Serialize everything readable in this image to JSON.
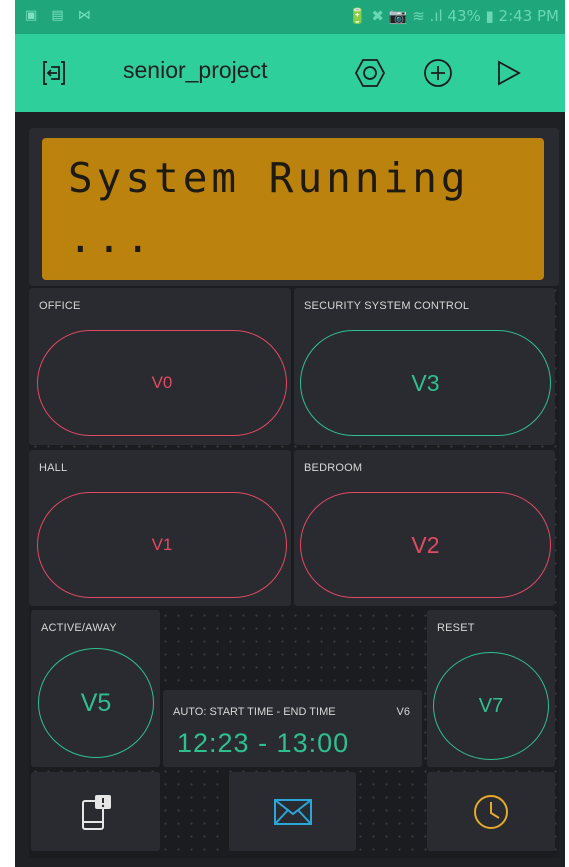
{
  "status_bar": {
    "left_icons": "▣ ▤ ⋈",
    "right_text": "🔋 ✖ 📷 ≋ .ıl 43% ▮ 2:43 PM"
  },
  "toolbar": {
    "title": "senior_project",
    "icons": [
      "exit-icon",
      "settings-icon",
      "add-icon",
      "play-icon"
    ]
  },
  "lcd": {
    "line1": "System Running",
    "line2": "..."
  },
  "widgets": {
    "office": {
      "label": "OFFICE",
      "pin": "V0"
    },
    "security": {
      "label": "SECURITY SYSTEM CONTROL",
      "pin": "V3"
    },
    "hall": {
      "label": "HALL",
      "pin": "V1"
    },
    "bedroom": {
      "label": "BEDROOM",
      "pin": "V2"
    },
    "active_away": {
      "label": "ACTIVE/AWAY",
      "pin": "V5"
    },
    "reset": {
      "label": "RESET",
      "pin": "V7"
    },
    "timer": {
      "label": "AUTO: START TIME - END TIME",
      "pin": "V6",
      "value": "12:23 - 13:00"
    }
  },
  "bottom_icons": [
    "notification-icon",
    "email-icon",
    "clock-icon"
  ],
  "colors": {
    "accent_green": "#2fc08f",
    "accent_red": "#e04a63",
    "toolbar": "#2ecf9a",
    "lcd": "#bb820d",
    "clock": "#e5a92c",
    "email": "#2aa7d9"
  }
}
